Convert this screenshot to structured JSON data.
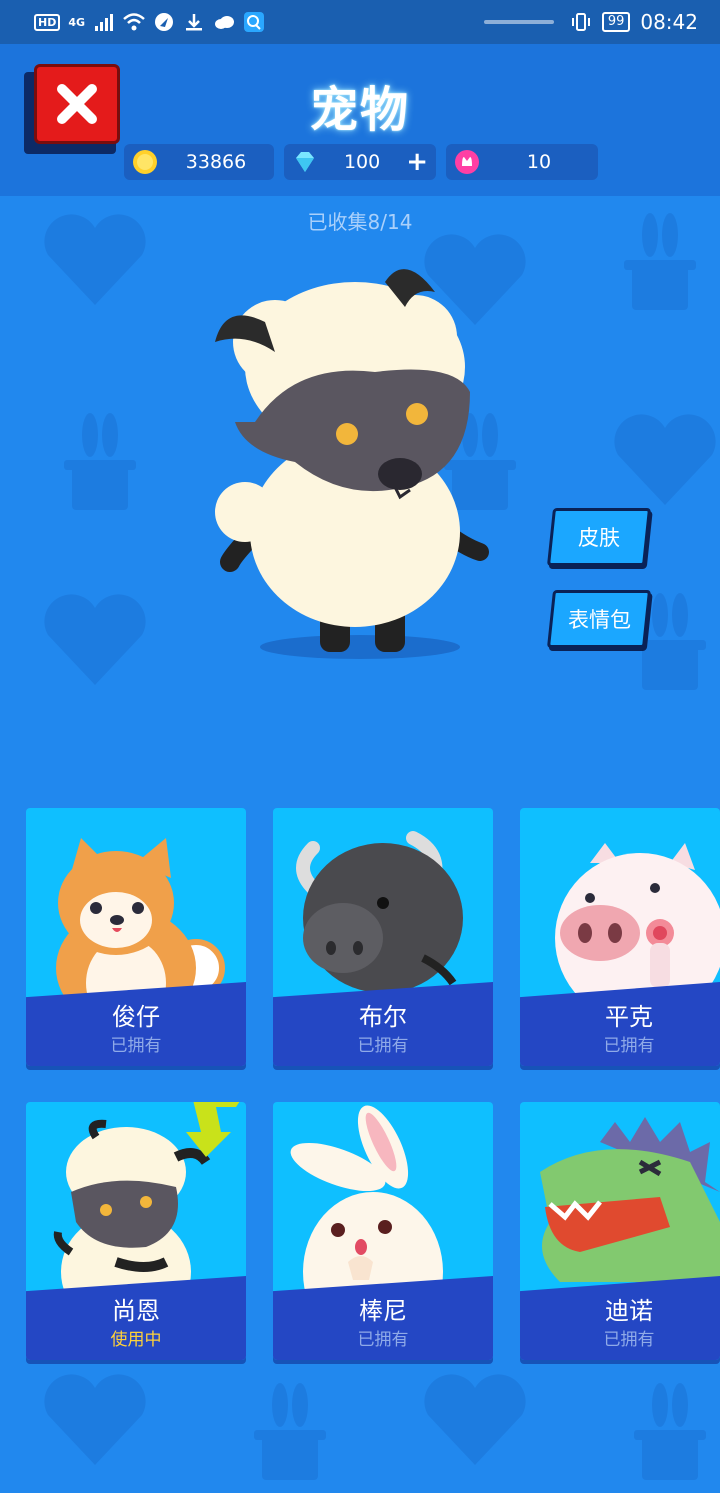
{
  "status_bar": {
    "hd": "HD",
    "network": "4G",
    "battery": "99",
    "time": "08:42"
  },
  "header": {
    "title": "宠物",
    "close_icon": "close-x-icon"
  },
  "currency": {
    "coins": "33866",
    "gems": "100",
    "gems_add": "+",
    "flowers": "10"
  },
  "collected": "已收集8/14",
  "selected_pet": "sheep",
  "side_buttons": {
    "skin": "皮肤",
    "emoji": "表情包"
  },
  "pets": [
    {
      "name": "俊仔",
      "status": "已拥有",
      "icon": "shiba-dog"
    },
    {
      "name": "布尔",
      "status": "已拥有",
      "icon": "bull"
    },
    {
      "name": "平克",
      "status": "已拥有",
      "icon": "pig"
    },
    {
      "name": "尚恩",
      "status": "使用中",
      "icon": "sheep"
    },
    {
      "name": "棒尼",
      "status": "已拥有",
      "icon": "rabbit"
    },
    {
      "name": "迪诺",
      "status": "已拥有",
      "icon": "dinosaur"
    }
  ],
  "colors": {
    "background": "#2188ee",
    "card": "#0fbfff",
    "card_band": "#2447c4",
    "active_status": "#ffd23a",
    "close_button": "#e41b1b"
  }
}
